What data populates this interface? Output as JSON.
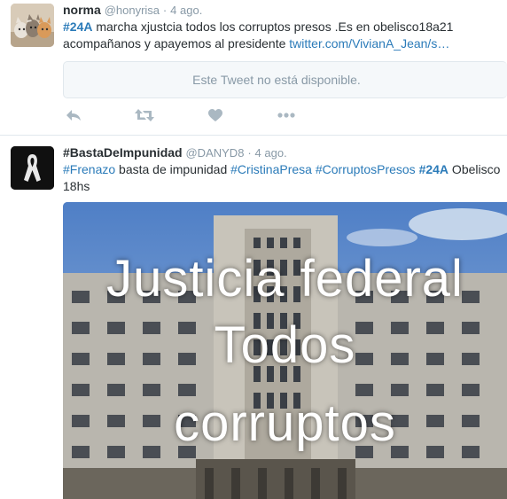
{
  "tweets": [
    {
      "fullname": "norma",
      "username": "@honyrisa",
      "separator": "·",
      "time": "4 ago.",
      "text_line1": {
        "hashtag": "#24A",
        "rest": " marcha xjustcia todos los corruptos presos .Es en obelisco18a21"
      },
      "text_line2": {
        "plain": "acompañanos y apayemos al presidente ",
        "link": "twitter.com/VivianA_Jean/s…"
      },
      "quoted_unavailable": "Este Tweet no está disponible.",
      "actions": [
        "reply-icon",
        "retweet-icon",
        "like-icon",
        "more-icon"
      ]
    },
    {
      "fullname": "#BastaDeImpunidad",
      "username": "@DANYD8",
      "separator": "·",
      "time": "4 ago.",
      "text_line1": {
        "h1": "#Frenazo",
        "t1": " basta de impunidad ",
        "h2": "#CristinaPresa",
        "t2": " ",
        "h3": "#CorruptosPresos",
        "t3": " ",
        "h4": "#24A",
        "t4": " Obelisco"
      },
      "text_line2": "18hs",
      "media_overlay": {
        "line1": "Justicia federal",
        "line2": "Todos",
        "line3": "corruptos"
      }
    }
  ],
  "colors": {
    "link": "#2b7bb9",
    "meta": "#8899a6",
    "text": "#292f33",
    "action_icon": "#aab8c2"
  }
}
